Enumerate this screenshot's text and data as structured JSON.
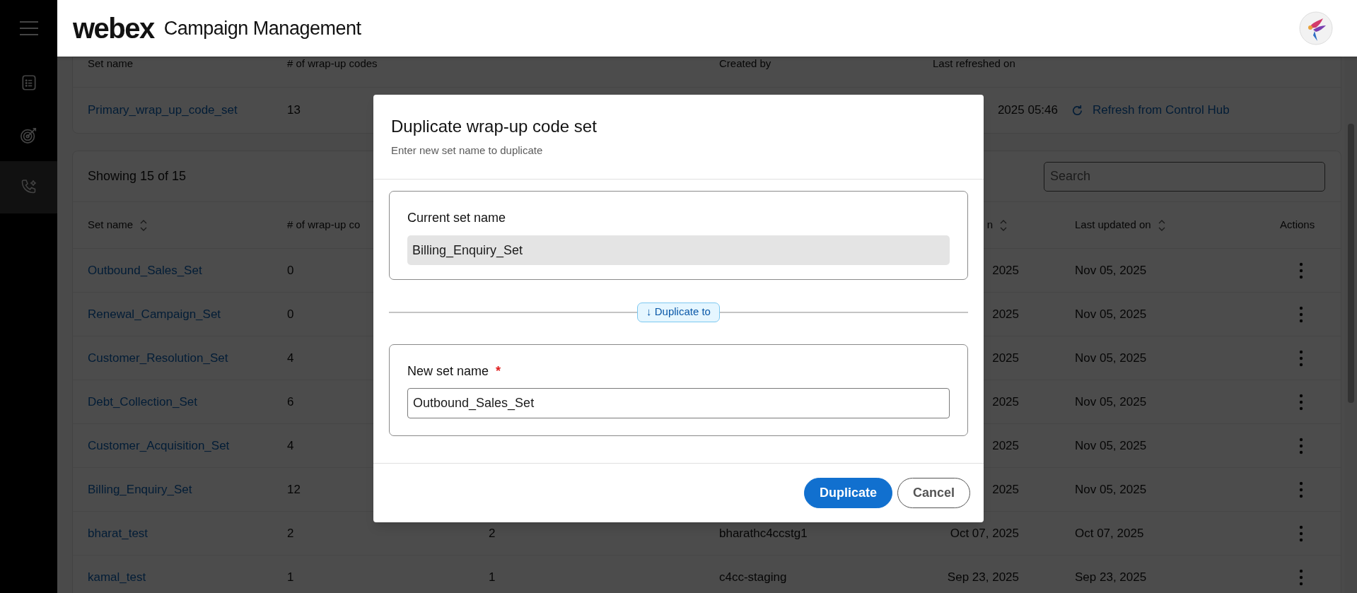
{
  "header": {
    "brand": "webex",
    "title": "Campaign Management"
  },
  "sidebar": {
    "items": [
      {
        "kind": "list",
        "selected": false
      },
      {
        "kind": "target",
        "selected": false
      },
      {
        "kind": "phone",
        "selected": true
      }
    ]
  },
  "summary_table": {
    "columns": [
      "Set name",
      "# of wrap-up codes",
      "Created by",
      "Last refreshed on"
    ],
    "row": {
      "set_name": "Primary_wrap_up_code_set",
      "count": "13",
      "last_refreshed": "2025 05:46",
      "refresh_link": "Refresh from Control Hub"
    }
  },
  "sets_table": {
    "showing": "Showing 15 of 15",
    "search": {
      "placeholder": "Search"
    },
    "columns": {
      "set_name": {
        "label": "Set name",
        "sortable": true
      },
      "count": {
        "label": "# of wrap-up co",
        "sortable": false
      },
      "created_on": {
        "label": "n",
        "sortable": true
      },
      "last_updated": {
        "label": "Last updated on",
        "sortable": true
      },
      "actions": {
        "label": "Actions",
        "sortable": false
      }
    },
    "rows": [
      {
        "set_name": "Outbound_Sales_Set",
        "count": "0",
        "created_on": "2025",
        "last_updated": "Nov 05, 2025"
      },
      {
        "set_name": "Renewal_Campaign_Set",
        "count": "0",
        "created_on": "2025",
        "last_updated": "Nov 05, 2025"
      },
      {
        "set_name": "Customer_Resolution_Set",
        "count": "4",
        "created_on": "2025",
        "last_updated": "Nov 05, 2025"
      },
      {
        "set_name": "Debt_Collection_Set",
        "count": "6",
        "created_on": "2025",
        "last_updated": "Nov 05, 2025"
      },
      {
        "set_name": "Customer_Acquisition_Set",
        "count": "4",
        "created_on": "2025",
        "last_updated": "Nov 05, 2025"
      },
      {
        "set_name": "Billing_Enquiry_Set",
        "count": "12",
        "created_on": "2025",
        "last_updated": "Nov 05, 2025"
      },
      {
        "set_name": "bharat_test",
        "count": "2",
        "column_3": "2",
        "created_by": "bharathc4ccstg1",
        "created_on": "Oct 07, 2025",
        "last_updated": "Oct 07, 2025"
      },
      {
        "set_name": "kamal_test",
        "count": "1",
        "column_3": "1",
        "created_by": "c4cc-staging",
        "created_on": "Sep 23, 2025",
        "last_updated": "Sep 23, 2025"
      }
    ]
  },
  "dialog": {
    "title": "Duplicate wrap-up code set",
    "subtitle": "Enter new set name to duplicate",
    "current": {
      "label": "Current set name",
      "value": "Billing_Enquiry_Set"
    },
    "divider_badge": "↓ Duplicate to",
    "new": {
      "label": "New set name",
      "required_mark": "*",
      "value": "Outbound_Sales_Set"
    },
    "buttons": [
      {
        "label": "Duplicate",
        "kind": "primary"
      },
      {
        "label": "Cancel",
        "kind": "secondary"
      }
    ]
  }
}
